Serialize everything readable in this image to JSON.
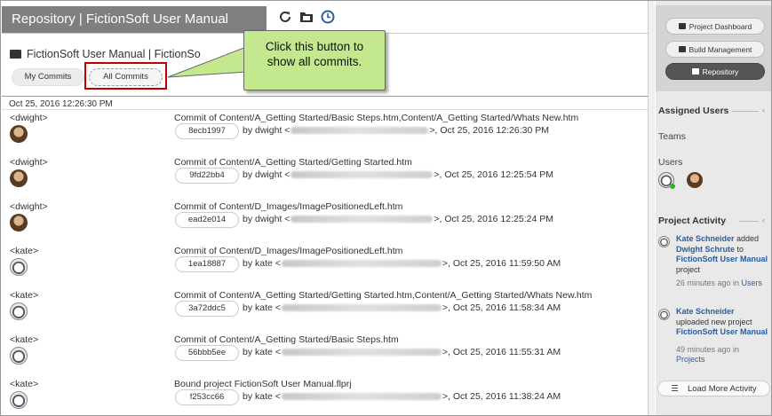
{
  "header": {
    "title": "Repository | FictionSoft User Manual",
    "icons": [
      "refresh-icon",
      "folder-icon",
      "clock-icon"
    ]
  },
  "project": {
    "name": "FictionSoft User Manual | FictionSo"
  },
  "filters": {
    "my_commits": "My Commits",
    "all_commits": "All Commits"
  },
  "callout": {
    "line1": "Click this button to",
    "line2": "show all commits."
  },
  "date_group": "Oct 25, 2016 12:26:30 PM",
  "commits": [
    {
      "user": "<dwight>",
      "avatar": "dwight",
      "message": "Commit of Content/A_Getting Started/Basic Steps.htm,Content/A_Getting Started/Whats New.htm",
      "hash": "8ecb1997",
      "by": "by dwight <",
      "tail": ">, Oct 25, 2016 12:26:30 PM"
    },
    {
      "user": "<dwight>",
      "avatar": "dwight",
      "message": "Commit of Content/A_Getting Started/Getting Started.htm",
      "hash": "9fd22bb4",
      "by": "by dwight <",
      "tail": ">, Oct 25, 2016 12:25:54 PM"
    },
    {
      "user": "<dwight>",
      "avatar": "dwight",
      "message": "Commit of Content/D_Images/ImagePositionedLeft.htm",
      "hash": "ead2e014",
      "by": "by dwight <",
      "tail": ">, Oct 25, 2016 12:25:24 PM"
    },
    {
      "user": "<kate>",
      "avatar": "kate",
      "message": "Commit of Content/D_Images/ImagePositionedLeft.htm",
      "hash": "1ea18887",
      "by": "by kate <",
      "tail": ">, Oct 25, 2016 11:59:50 AM"
    },
    {
      "user": "<kate>",
      "avatar": "kate",
      "message": "Commit of Content/A_Getting Started/Getting Started.htm,Content/A_Getting Started/Whats New.htm",
      "hash": "3a72ddc5",
      "by": "by kate <",
      "tail": ">, Oct 25, 2016 11:58:34 AM"
    },
    {
      "user": "<kate>",
      "avatar": "kate",
      "message": "Commit of Content/A_Getting Started/Basic Steps.htm",
      "hash": "56bbb5ee",
      "by": "by kate <",
      "tail": ">, Oct 25, 2016 11:55:31 AM"
    },
    {
      "user": "<kate>",
      "avatar": "kate",
      "message": "Bound project FictionSoft User Manual.flprj",
      "hash": "f253cc66",
      "by": "by kate <",
      "tail": ">, Oct 25, 2016 11:38:24 AM"
    }
  ],
  "right_panel": {
    "buttons": [
      "Project Dashboard",
      "Build Management",
      "Repository"
    ],
    "assigned_users": "Assigned Users",
    "teams": "Teams",
    "users": "Users",
    "project_activity": "Project Activity",
    "activity": [
      {
        "actor": "Kate Schneider",
        "verb1": " added ",
        "target": "Dwight Schrute",
        "verb2": " to ",
        "project": "FictionSoft User Manual",
        "end": " project",
        "when": "26 minutes ago in ",
        "where": "Users"
      },
      {
        "actor": "Kate Schneider",
        "verb1": " uploaded new project ",
        "target": "",
        "verb2": "",
        "project": "FictionSoft User Manual",
        "end": "",
        "when": "49 minutes ago in ",
        "where": "Projects"
      }
    ],
    "load_more": "Load More Activity"
  },
  "colors": {
    "title_bar": "#7f7f7f",
    "callout_bg": "#c4e88e",
    "highlight_border": "#c00000",
    "link": "#2a5d9e"
  }
}
